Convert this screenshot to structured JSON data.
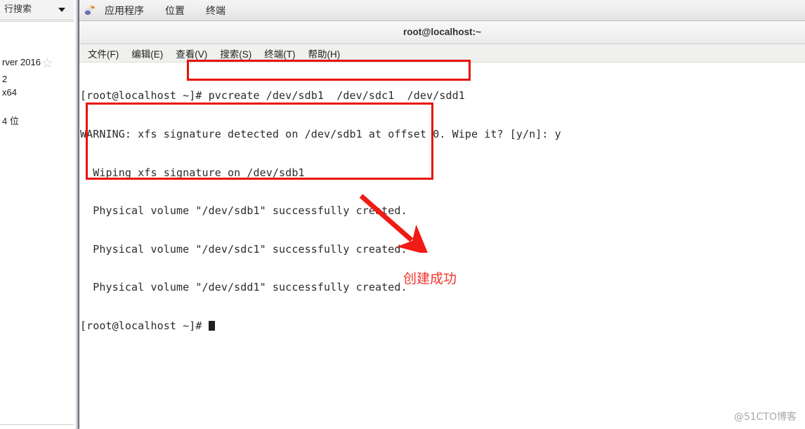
{
  "background_window": {
    "search": {
      "value": "行搜索",
      "dropdown_icon": "chevron-down-icon"
    },
    "list_items": [
      {
        "label": "rver 2016",
        "icon": "star-icon"
      },
      {
        "label": "2"
      },
      {
        "label": "x64"
      },
      {
        "label": "4 位"
      }
    ]
  },
  "gnome_panel": {
    "apps_icon": "gnome-applications-icon",
    "menus": [
      {
        "label": "应用程序"
      },
      {
        "label": "位置"
      },
      {
        "label": "终端"
      }
    ]
  },
  "terminal": {
    "title": "root@localhost:~",
    "menubar": [
      {
        "label": "文件(F)"
      },
      {
        "label": "编辑(E)"
      },
      {
        "label": "查看(V)"
      },
      {
        "label": "搜索(S)"
      },
      {
        "label": "终端(T)"
      },
      {
        "label": "帮助(H)"
      }
    ],
    "lines": [
      "[root@localhost ~]# pvcreate /dev/sdb1  /dev/sdc1  /dev/sdd1",
      "WARNING: xfs signature detected on /dev/sdb1 at offset 0. Wipe it? [y/n]: y",
      "  Wiping xfs signature on /dev/sdb1",
      "  Physical volume \"/dev/sdb1\" successfully created.",
      "  Physical volume \"/dev/sdc1\" successfully created.",
      "  Physical volume \"/dev/sdd1\" successfully created.",
      "[root@localhost ~]# "
    ],
    "cursor": "block-cursor"
  },
  "annotations": {
    "accent_color": "#e8120c",
    "command_box_label": "pvcreate command highlight",
    "output_box_label": "physical volume creation output highlight",
    "arrow_label": "red-arrow-pointing-to-note",
    "note_text": "创建成功"
  },
  "watermark": {
    "text": "@51CTO博客"
  }
}
